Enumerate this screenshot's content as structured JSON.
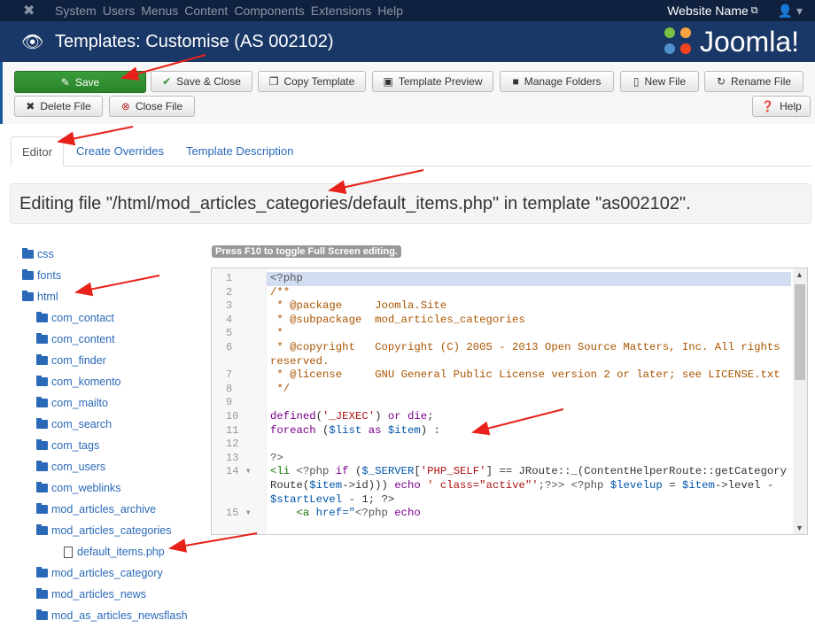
{
  "topbar": {
    "menu": [
      "System",
      "Users",
      "Menus",
      "Content",
      "Components",
      "Extensions",
      "Help"
    ],
    "site_name": "Website Name",
    "user_icon": "user-icon"
  },
  "header": {
    "title": "Templates: Customise (AS 002102)",
    "logo": "Joomla!"
  },
  "toolbar": {
    "buttons": [
      {
        "label": "Save",
        "icon": "edit-icon"
      },
      {
        "label": "Save & Close",
        "icon": "check-icon"
      },
      {
        "label": "Copy Template",
        "icon": "copy-icon"
      },
      {
        "label": "Template Preview",
        "icon": "picture-icon"
      },
      {
        "label": "Manage Folders",
        "icon": "folder-icon"
      },
      {
        "label": "New File",
        "icon": "file-icon"
      },
      {
        "label": "Rename File",
        "icon": "refresh-icon"
      },
      {
        "label": "Delete File",
        "icon": "x-icon"
      },
      {
        "label": "Close File",
        "icon": "close-circle-icon"
      },
      {
        "label": "Help",
        "icon": "question-icon"
      }
    ]
  },
  "tabs": [
    {
      "label": "Editor",
      "active": true
    },
    {
      "label": "Create Overrides"
    },
    {
      "label": "Template Description"
    }
  ],
  "banner": "Editing file \"/html/mod_articles_categories/default_items.php\" in template \"as002102\".",
  "f10_hint": "Press F10 to toggle Full Screen editing.",
  "tree": [
    {
      "label": "css",
      "type": "folder",
      "level": 0
    },
    {
      "label": "fonts",
      "type": "folder",
      "level": 0
    },
    {
      "label": "html",
      "type": "folder",
      "level": 0
    },
    {
      "label": "com_contact",
      "type": "folder",
      "level": 1
    },
    {
      "label": "com_content",
      "type": "folder",
      "level": 1
    },
    {
      "label": "com_finder",
      "type": "folder",
      "level": 1
    },
    {
      "label": "com_komento",
      "type": "folder",
      "level": 1
    },
    {
      "label": "com_mailto",
      "type": "folder",
      "level": 1
    },
    {
      "label": "com_search",
      "type": "folder",
      "level": 1
    },
    {
      "label": "com_tags",
      "type": "folder",
      "level": 1
    },
    {
      "label": "com_users",
      "type": "folder",
      "level": 1
    },
    {
      "label": "com_weblinks",
      "type": "folder",
      "level": 1
    },
    {
      "label": "mod_articles_archive",
      "type": "folder",
      "level": 1
    },
    {
      "label": "mod_articles_categories",
      "type": "folder",
      "level": 1
    },
    {
      "label": "default_items.php",
      "type": "file",
      "level": 2
    },
    {
      "label": "mod_articles_category",
      "type": "folder",
      "level": 1
    },
    {
      "label": "mod_articles_news",
      "type": "folder",
      "level": 1
    },
    {
      "label": "mod_as_articles_newsflash",
      "type": "folder",
      "level": 1
    }
  ],
  "code": [
    {
      "no": "1",
      "seg": [
        [
          "<?php",
          "meta"
        ]
      ]
    },
    {
      "no": "2",
      "seg": [
        [
          "/**",
          "cm"
        ]
      ]
    },
    {
      "no": "3",
      "seg": [
        [
          " * @package     Joomla.Site",
          "cm"
        ]
      ]
    },
    {
      "no": "4",
      "seg": [
        [
          " * @subpackage  mod_articles_categories",
          "cm"
        ]
      ]
    },
    {
      "no": "5",
      "seg": [
        [
          " *",
          "cm"
        ]
      ]
    },
    {
      "no": "6",
      "seg": [
        [
          " * @copyright   Copyright (C) 2005 - 2013 Open Source Matters, Inc. All rights reserved.",
          "cm"
        ]
      ]
    },
    {
      "no": "7",
      "seg": [
        [
          " * @license     GNU General Public License version 2 or later; see LICENSE.txt",
          "cm"
        ]
      ]
    },
    {
      "no": "8",
      "seg": [
        [
          " */",
          "cm"
        ]
      ]
    },
    {
      "no": "9",
      "seg": [
        [
          " ",
          "plain"
        ]
      ]
    },
    {
      "no": "10",
      "seg": [
        [
          "defined",
          "kw"
        ],
        [
          "(",
          "plain"
        ],
        [
          "'_JEXEC'",
          "str"
        ],
        [
          ") ",
          "plain"
        ],
        [
          "or die",
          "kw"
        ],
        [
          ";",
          "plain"
        ]
      ]
    },
    {
      "no": "11",
      "seg": [
        [
          "foreach",
          "kw"
        ],
        [
          " (",
          "plain"
        ],
        [
          "$list",
          "var"
        ],
        [
          " as ",
          "kw"
        ],
        [
          "$item",
          "var"
        ],
        [
          ") :",
          "plain"
        ]
      ]
    },
    {
      "no": "12",
      "seg": [
        [
          " ",
          "plain"
        ]
      ]
    },
    {
      "no": "13",
      "seg": [
        [
          "?>",
          "meta"
        ]
      ]
    },
    {
      "no": "14 ▾",
      "seg": [
        [
          "<li",
          "tag"
        ],
        [
          " <?php ",
          "meta"
        ],
        [
          "if",
          "kw"
        ],
        [
          " (",
          "plain"
        ],
        [
          "$_SERVER",
          "var"
        ],
        [
          "[",
          "plain"
        ],
        [
          "'PHP_SELF'",
          "str"
        ],
        [
          "] == JRoute::_(ContentHelperRoute::getCategoryRoute(",
          "plain"
        ],
        [
          "$item",
          "var"
        ],
        [
          "->id))) ",
          "plain"
        ],
        [
          "echo",
          "kw"
        ],
        [
          " ' class=\"active\"'",
          "str"
        ],
        [
          ";?>> <?php ",
          "meta"
        ],
        [
          "$levelup",
          "var"
        ],
        [
          " = ",
          "plain"
        ],
        [
          "$item",
          "var"
        ],
        [
          "->level - ",
          "plain"
        ],
        [
          "$startLevel",
          "var"
        ],
        [
          " - 1; ?>",
          "plain"
        ]
      ]
    },
    {
      "no": "15 ▾",
      "seg": [
        [
          "    ",
          "plain"
        ],
        [
          "<a ",
          "tag"
        ],
        [
          "href=\"",
          "var"
        ],
        [
          "<?php ",
          "meta"
        ],
        [
          "echo",
          "kw"
        ]
      ]
    }
  ],
  "colors": {
    "topbar": "#0f213e",
    "header": "#1a3867",
    "save": "#2f8f2f",
    "link": "#2a69b8"
  }
}
